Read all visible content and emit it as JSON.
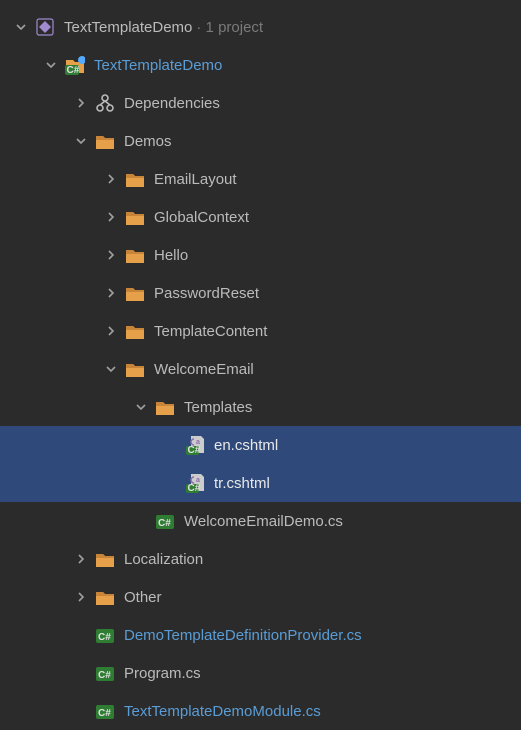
{
  "indentUnit": 30,
  "baseIndent": 12,
  "tree": [
    {
      "depth": 0,
      "caret": "down",
      "icon": "solution",
      "label": "TextTemplateDemo",
      "hint": "· 1 project",
      "link": false,
      "selected": false
    },
    {
      "depth": 1,
      "caret": "down",
      "icon": "csproj",
      "label": "TextTemplateDemo",
      "link": true,
      "selected": false
    },
    {
      "depth": 2,
      "caret": "right",
      "icon": "deps",
      "label": "Dependencies",
      "link": false,
      "selected": false
    },
    {
      "depth": 2,
      "caret": "down",
      "icon": "folder",
      "label": "Demos",
      "link": false,
      "selected": false
    },
    {
      "depth": 3,
      "caret": "right",
      "icon": "folder",
      "label": "EmailLayout",
      "link": false,
      "selected": false
    },
    {
      "depth": 3,
      "caret": "right",
      "icon": "folder",
      "label": "GlobalContext",
      "link": false,
      "selected": false
    },
    {
      "depth": 3,
      "caret": "right",
      "icon": "folder",
      "label": "Hello",
      "link": false,
      "selected": false
    },
    {
      "depth": 3,
      "caret": "right",
      "icon": "folder",
      "label": "PasswordReset",
      "link": false,
      "selected": false
    },
    {
      "depth": 3,
      "caret": "right",
      "icon": "folder",
      "label": "TemplateContent",
      "link": false,
      "selected": false
    },
    {
      "depth": 3,
      "caret": "down",
      "icon": "folder",
      "label": "WelcomeEmail",
      "link": false,
      "selected": false
    },
    {
      "depth": 4,
      "caret": "down",
      "icon": "folder",
      "label": "Templates",
      "link": false,
      "selected": false
    },
    {
      "depth": 5,
      "caret": "none",
      "icon": "cshtml",
      "label": "en.cshtml",
      "link": false,
      "selected": true
    },
    {
      "depth": 5,
      "caret": "none",
      "icon": "cshtml",
      "label": "tr.cshtml",
      "link": false,
      "selected": true
    },
    {
      "depth": 4,
      "caret": "none",
      "icon": "cs",
      "label": "WelcomeEmailDemo.cs",
      "link": false,
      "selected": false
    },
    {
      "depth": 2,
      "caret": "right",
      "icon": "folder",
      "label": "Localization",
      "link": false,
      "selected": false
    },
    {
      "depth": 2,
      "caret": "right",
      "icon": "folder",
      "label": "Other",
      "link": false,
      "selected": false
    },
    {
      "depth": 2,
      "caret": "none",
      "icon": "cs",
      "label": "DemoTemplateDefinitionProvider.cs",
      "link": true,
      "selected": false
    },
    {
      "depth": 2,
      "caret": "none",
      "icon": "cs",
      "label": "Program.cs",
      "link": false,
      "selected": false
    },
    {
      "depth": 2,
      "caret": "none",
      "icon": "cs",
      "label": "TextTemplateDemoModule.cs",
      "link": true,
      "selected": false
    }
  ]
}
